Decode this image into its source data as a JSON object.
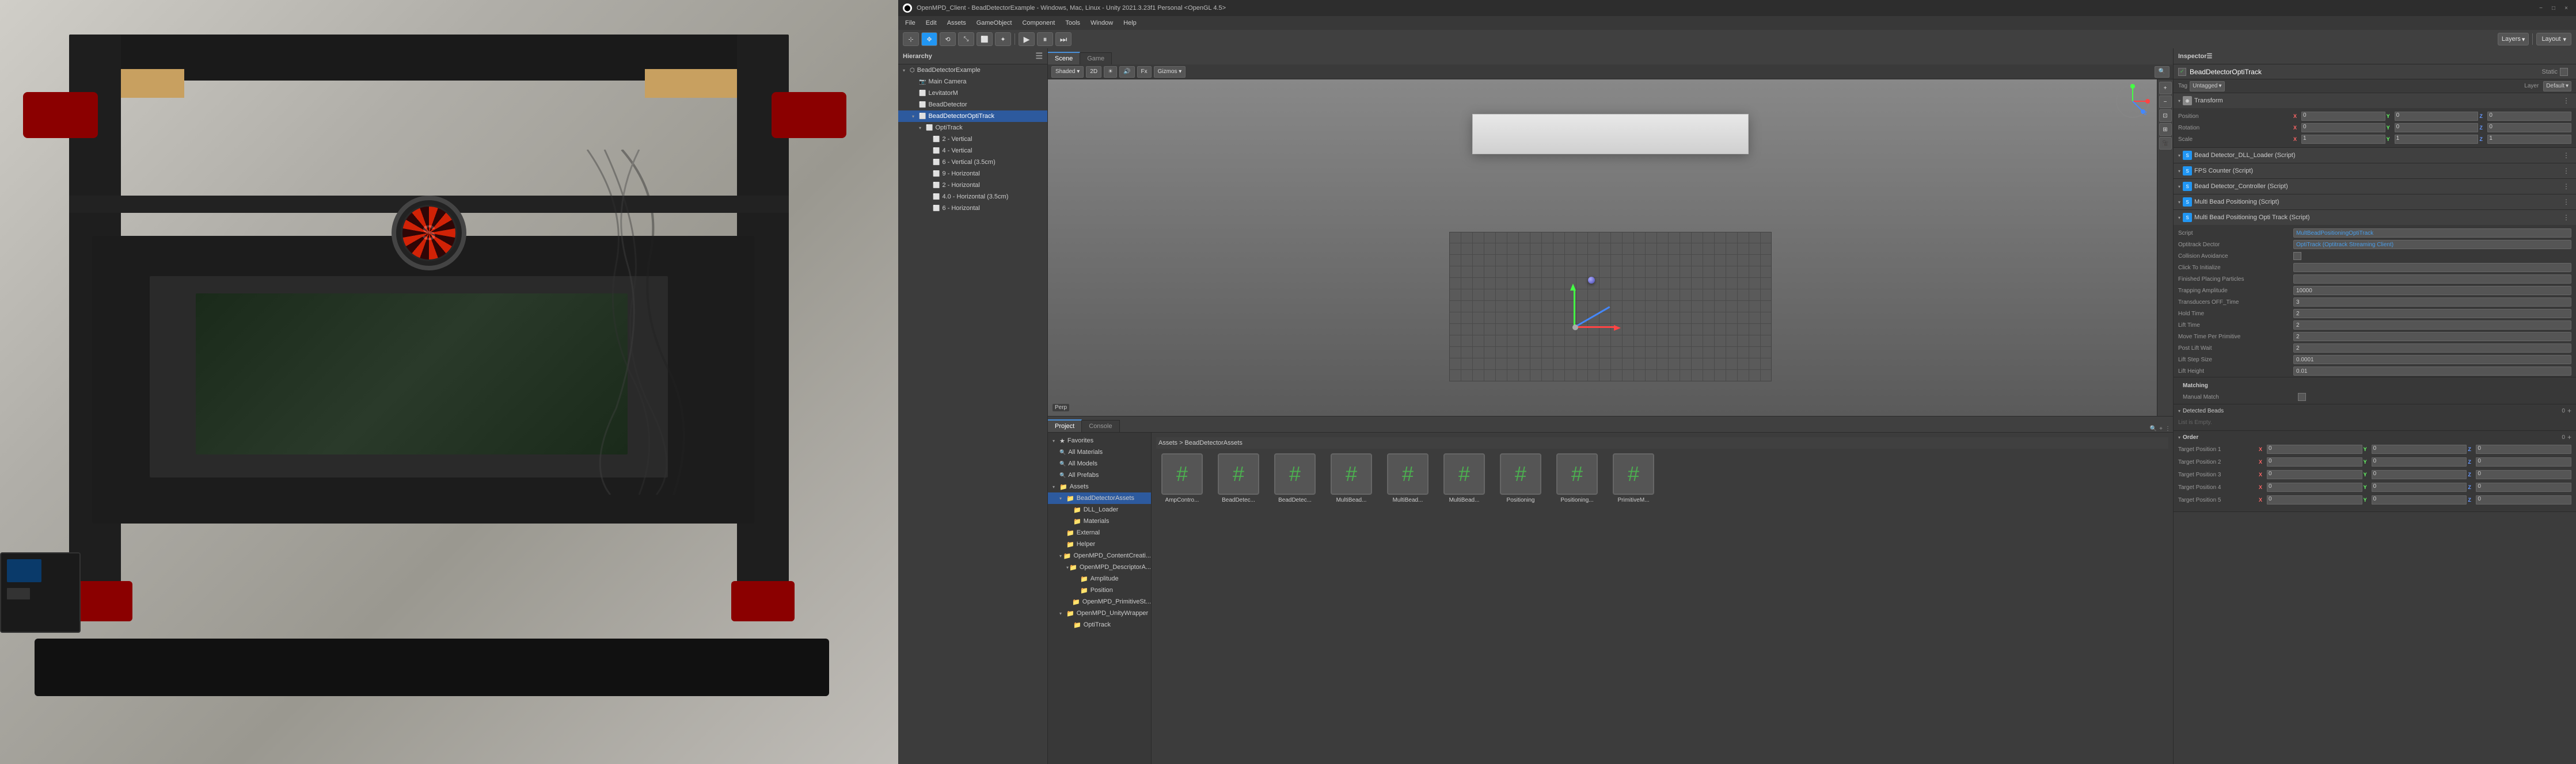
{
  "photo": {
    "alt": "OpenMPD hardware setup - black frame machine with red cameras"
  },
  "titleBar": {
    "text": "OpenMPD_Client - BeadDetectorExample - Windows, Mac, Linux - Unity 2021.3.23f1 Personal <OpenGL 4.5>",
    "minimize": "−",
    "maximize": "□",
    "close": "×"
  },
  "menuBar": {
    "items": [
      "File",
      "Edit",
      "Assets",
      "GameObject",
      "Component",
      "Tools",
      "Window",
      "Help"
    ]
  },
  "toolbar": {
    "tools": [
      "⊹",
      "✥",
      "⟲",
      "⤡",
      "⬜",
      "✦"
    ],
    "play": "▶",
    "pause": "⏸",
    "step": "⏭",
    "layers_label": "Layers",
    "layout_label": "Layout"
  },
  "hierarchy": {
    "title": "Hierarchy",
    "items": [
      {
        "name": "BeadDetectorExample",
        "indent": 0,
        "expanded": true,
        "selected": false
      },
      {
        "name": "Main Camera",
        "indent": 1,
        "expanded": false,
        "selected": false
      },
      {
        "name": "LevitatorM",
        "indent": 1,
        "expanded": false,
        "selected": false
      },
      {
        "name": "BeadDetector",
        "indent": 1,
        "expanded": false,
        "selected": false
      },
      {
        "name": "BeadDetectorOptiTrack",
        "indent": 1,
        "expanded": true,
        "selected": true
      },
      {
        "name": "OptiTrack",
        "indent": 2,
        "expanded": true,
        "selected": false
      },
      {
        "name": "2 - Vertical",
        "indent": 3,
        "expanded": false,
        "selected": false
      },
      {
        "name": "4 - Vertical",
        "indent": 3,
        "expanded": false,
        "selected": false
      },
      {
        "name": "6 - Vertical (3.5cm)",
        "indent": 3,
        "expanded": false,
        "selected": false
      },
      {
        "name": "9 - Horizontal",
        "indent": 3,
        "expanded": false,
        "selected": false
      },
      {
        "name": "2 - Horizontal",
        "indent": 3,
        "expanded": false,
        "selected": false
      },
      {
        "name": "4.0 - Horizontal (3.5cm)",
        "indent": 3,
        "expanded": false,
        "selected": false
      },
      {
        "name": "6 - Horizontal",
        "indent": 3,
        "expanded": false,
        "selected": false
      }
    ]
  },
  "sceneTabs": [
    "Scene",
    "Game"
  ],
  "activeSceneTab": "Scene",
  "inspector": {
    "title": "Inspector",
    "objectName": "BeadDetectorOptiTrack",
    "tag": "Untagged",
    "layer": "Default",
    "layerLabel": "Layer",
    "staticLabel": "Static",
    "transform": {
      "title": "Transform",
      "position": {
        "x": "0",
        "y": "0",
        "z": "0"
      },
      "rotation": {
        "x": "0",
        "y": "0",
        "z": "0"
      },
      "scale": {
        "x": "1",
        "y": "1",
        "z": "1"
      }
    },
    "components": [
      {
        "name": "Bead Detector_DLL_Loader (Script)",
        "icon": "S"
      },
      {
        "name": "FPS Counter (Script)",
        "icon": "S"
      },
      {
        "name": "Bead Detector_Controller (Script)",
        "icon": "S"
      },
      {
        "name": "Multi Bead Positioning (Script)",
        "icon": "S"
      },
      {
        "name": "Multi Bead Positioning Opti Track (Script)",
        "icon": "S"
      }
    ],
    "multiBead": {
      "scriptLabel": "Script",
      "scriptValue": "MultBeadPositioningOptiTrack",
      "fields": [
        {
          "label": "Optitrack Dector",
          "value": "OptiTrack (Optitrack Streaming Client)"
        },
        {
          "label": "Collision Avoidance",
          "checkbox": true,
          "checked": false
        },
        {
          "label": "Click To Initialize",
          "value": ""
        },
        {
          "label": "Finished Placing Particles",
          "value": ""
        },
        {
          "label": "Trapping Amplitude",
          "value": "10000"
        },
        {
          "label": "Transducers OFF_Time",
          "value": "3"
        },
        {
          "label": "Hold Time",
          "value": "2"
        },
        {
          "label": "Lift Time",
          "value": "2"
        },
        {
          "label": "Move Time Per Primitive",
          "value": "2"
        },
        {
          "label": "Post Lift Wait",
          "value": "2"
        },
        {
          "label": "Lift Step Size",
          "value": "0.0001"
        },
        {
          "label": "Lift Height",
          "value": "0.01"
        }
      ],
      "matching": {
        "label": "Matching",
        "manual": "Manual Match"
      },
      "detectedBeads": {
        "label": "Detected Beads",
        "count": "0",
        "listEmpty": "List is Empty."
      },
      "order": {
        "label": "Order",
        "count": "0",
        "targets": [
          {
            "label": "Target Position 1",
            "x": "0",
            "y": "0",
            "z": "0"
          },
          {
            "label": "Target Position 2",
            "x": "0",
            "y": "0",
            "z": "0"
          },
          {
            "label": "Target Position 3",
            "x": "0",
            "y": "0",
            "z": "0"
          },
          {
            "label": "Target Position 4",
            "x": "0",
            "y": "0",
            "z": "0"
          },
          {
            "label": "Target Position 5",
            "x": "0",
            "y": "0",
            "z": "0"
          }
        ]
      }
    }
  },
  "project": {
    "title": "Project",
    "consoletab": "Console",
    "favorites": {
      "label": "Favorites",
      "items": [
        "All Materials",
        "All Models",
        "All Prefabs"
      ]
    },
    "assets": {
      "label": "Assets",
      "items": [
        {
          "name": "BeadDetectorAssets",
          "expanded": true
        },
        {
          "name": "DLL_Loader",
          "indent": 1
        },
        {
          "name": "Materials",
          "indent": 1
        },
        {
          "name": "External",
          "indent": 0
        },
        {
          "name": "Helper",
          "indent": 0
        },
        {
          "name": "OpenMPD_ContentCreati...",
          "expanded": true
        },
        {
          "name": "OpenMPD_DescriptorA...",
          "indent": 1
        },
        {
          "name": "Amplitude",
          "indent": 2
        },
        {
          "name": "Position",
          "indent": 2
        },
        {
          "name": "OpenMPD_PrimitiveSt...",
          "indent": 1
        },
        {
          "name": "OpenMPD_UnityWrapper",
          "indent": 0
        },
        {
          "name": "OptiTrack",
          "indent": 1
        }
      ]
    },
    "assetGrid": {
      "path": "Assets > BeadDetectorAssets",
      "items": [
        {
          "name": "AmpContro...",
          "icon": "#"
        },
        {
          "name": "BeadDetec...",
          "icon": "#"
        },
        {
          "name": "BeadDetec...",
          "icon": "#"
        },
        {
          "name": "MultiBead...",
          "icon": "#"
        },
        {
          "name": "MultiBead...",
          "icon": "#"
        },
        {
          "name": "MultiBead...",
          "icon": "#"
        },
        {
          "name": "Positioning",
          "icon": "#"
        },
        {
          "name": "Positioning...",
          "icon": "#"
        },
        {
          "name": "PrimitiveM...",
          "icon": "#"
        }
      ]
    }
  }
}
